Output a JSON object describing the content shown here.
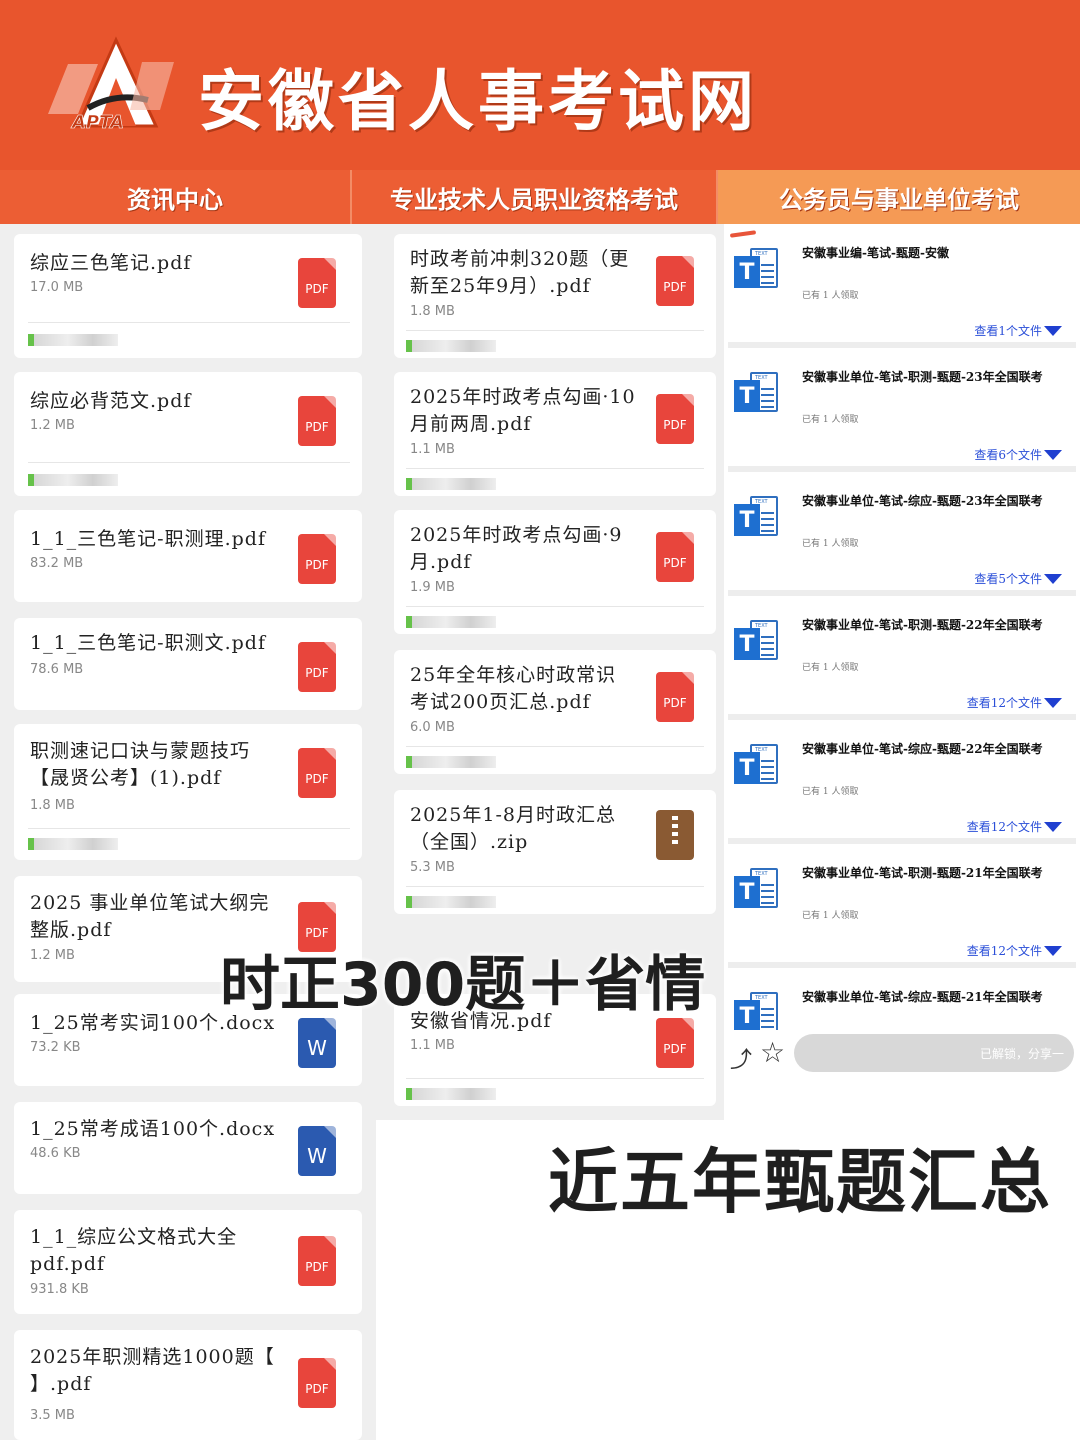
{
  "header": {
    "title": "安徽省人事考试网",
    "logo_text": "APTA"
  },
  "nav": {
    "tabs": [
      {
        "label": "资讯中心"
      },
      {
        "label": "专业技术人员职业资格考试"
      },
      {
        "label": "公务员与事业单位考试"
      }
    ]
  },
  "left_files": [
    {
      "name": "综应三色笔记.pdf",
      "size": "17.0 MB",
      "type": "PDF"
    },
    {
      "name": "综应必背范文.pdf",
      "size": "1.2 MB",
      "type": "PDF"
    },
    {
      "name": "1_1_三色笔记-职测理.pdf",
      "size": "83.2 MB",
      "type": "PDF"
    },
    {
      "name": "1_1_三色笔记-职测文.pdf",
      "size": "78.6 MB",
      "type": "PDF"
    },
    {
      "name": "职测速记口诀与蒙题技巧【晟贤公考】(1).pdf",
      "size": "1.8 MB",
      "type": "PDF"
    },
    {
      "name": "2025 事业单位笔试大纲完整版.pdf",
      "size": "1.2 MB",
      "type": "PDF"
    },
    {
      "name": "1_25常考实词100个.docx",
      "size": "73.2 KB",
      "type": "W"
    },
    {
      "name": "1_25常考成语100个.docx",
      "size": "48.6 KB",
      "type": "W"
    },
    {
      "name": "1_1_综应公文格式大全pdf.pdf",
      "size": "931.8 KB",
      "type": "PDF"
    },
    {
      "name": "2025年职测精选1000题【 】.pdf",
      "size": "3.5 MB",
      "type": "PDF"
    }
  ],
  "mid_files": [
    {
      "name": "时政考前冲刺320题（更新至25年9月）.pdf",
      "size": "1.8 MB",
      "type": "PDF"
    },
    {
      "name": "2025年时政考点勾画·10月前两周.pdf",
      "size": "1.1 MB",
      "type": "PDF"
    },
    {
      "name": "2025年时政考点勾画·9月.pdf",
      "size": "1.9 MB",
      "type": "PDF"
    },
    {
      "name": "25年全年核心时政常识考试200页汇总.pdf",
      "size": "6.0 MB",
      "type": "PDF"
    },
    {
      "name": "2025年1-8月时政汇总（全国）.zip",
      "size": "5.3 MB",
      "type": "zip"
    },
    {
      "name": "安徽省情况.pdf",
      "size": "1.1 MB",
      "type": "PDF"
    }
  ],
  "right_items": [
    {
      "title": "安徽事业编-笔试-甄题-安徽",
      "sub": "已有 1 人领取",
      "link": "查看1个文件"
    },
    {
      "title": "安徽事业单位-笔试-职测-甄题-23年全国联考",
      "sub": "已有 1 人领取",
      "link": "查看6个文件"
    },
    {
      "title": "安徽事业单位-笔试-综应-甄题-23年全国联考",
      "sub": "已有 1 人领取",
      "link": "查看5个文件"
    },
    {
      "title": "安徽事业单位-笔试-职测-甄题-22年全国联考",
      "sub": "已有 1 人领取",
      "link": "查看12个文件"
    },
    {
      "title": "安徽事业单位-笔试-综应-甄题-22年全国联考",
      "sub": "已有 1 人领取",
      "link": "查看12个文件"
    },
    {
      "title": "安徽事业单位-笔试-职测-甄题-21年全国联考",
      "sub": "已有 1 人领取",
      "link": "查看12个文件"
    },
    {
      "title": "安徽事业单位-笔试-综应-甄题-21年全国联考",
      "sub": "",
      "link": ""
    }
  ],
  "bottom_bar": {
    "unlock_text": "已解锁，分享一"
  },
  "overlay": {
    "line1": "时正300题＋省情",
    "line2": "近五年甄题汇总"
  },
  "colors": {
    "header": "#e8552d",
    "pdf": "#e8453c",
    "word": "#2b5ab0",
    "zip": "#8a5a33",
    "link": "#2b4fd8"
  }
}
